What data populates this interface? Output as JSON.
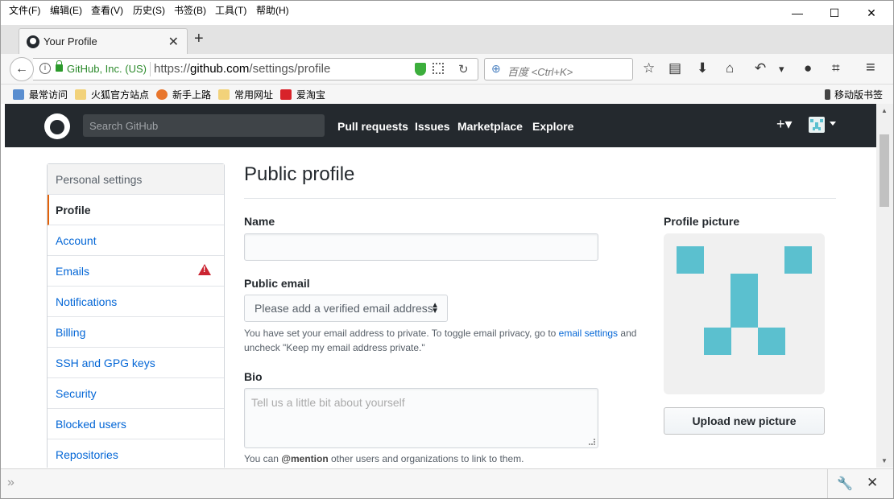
{
  "menu": [
    "文件(F)",
    "编辑(E)",
    "查看(V)",
    "历史(S)",
    "书签(B)",
    "工具(T)",
    "帮助(H)"
  ],
  "window_controls": {
    "minimize": "—",
    "maximize": "☐",
    "close": "✕"
  },
  "tab": {
    "title": "Your Profile",
    "close": "✕",
    "new_tab": "+"
  },
  "nav": {
    "back": "←",
    "info": "i",
    "org": "GitHub, Inc. (US)",
    "url_prefix": "https://",
    "url_host": "github.com",
    "url_path": "/settings/profile",
    "reload": "↻",
    "search_placeholder": "百度 <Ctrl+K>",
    "search_icon": "⊕"
  },
  "toolbar_icons": {
    "bookmark": "☆",
    "reader": "▤",
    "download": "⬇",
    "home": "⌂",
    "undo": "↶",
    "dropdown": "▾",
    "chat": "●",
    "crop": "⌗",
    "menu": "≡"
  },
  "bookmarks": [
    "最常访问",
    "火狐官方站点",
    "新手上路",
    "常用网址",
    "爱淘宝"
  ],
  "mobile_bookmarks": "移动版书签",
  "github": {
    "search_placeholder": "Search GitHub",
    "nav": [
      "Pull requests",
      "Issues",
      "Marketplace",
      "Explore"
    ],
    "plus": "+▾"
  },
  "sidebar": {
    "header": "Personal settings",
    "items": [
      "Profile",
      "Account",
      "Emails",
      "Notifications",
      "Billing",
      "SSH and GPG keys",
      "Security",
      "Blocked users",
      "Repositories"
    ]
  },
  "profile": {
    "title": "Public profile",
    "name_label": "Name",
    "name_value": "",
    "email_label": "Public email",
    "email_select": "Please add a verified email address",
    "email_note_1": "You have set your email address to private. To toggle email privacy, go to",
    "email_note_link": "email settings",
    "email_note_2": "and",
    "email_note_3": "uncheck \"Keep my email address private.\"",
    "bio_label": "Bio",
    "bio_placeholder": "Tell us a little bit about yourself",
    "bio_note_1": "You can",
    "bio_note_mention": "@mention",
    "bio_note_2": "other users and organizations to link to them.",
    "picture_label": "Profile picture",
    "upload_button": "Upload new picture"
  },
  "colors": {
    "github_header": "#24292e",
    "link": "#0366d6",
    "identicon": "#5bc0cf",
    "selected_accent": "#e36209",
    "warning": "#cb2431"
  }
}
